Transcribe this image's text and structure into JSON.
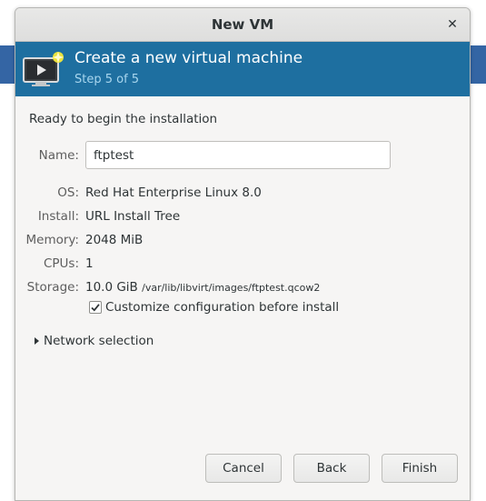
{
  "window": {
    "title": "New VM"
  },
  "banner": {
    "heading": "Create a new virtual machine",
    "step": "Step 5 of 5"
  },
  "summary": {
    "intro": "Ready to begin the installation",
    "name_label": "Name:",
    "name_value": "ftptest",
    "os_label": "OS:",
    "os_value": "Red Hat Enterprise Linux 8.0",
    "install_label": "Install:",
    "install_value": "URL Install Tree",
    "memory_label": "Memory:",
    "memory_value": "2048 MiB",
    "cpus_label": "CPUs:",
    "cpus_value": "1",
    "storage_label": "Storage:",
    "storage_size": "10.0 GiB",
    "storage_path": "/var/lib/libvirt/images/ftptest.qcow2"
  },
  "options": {
    "customize_label": "Customize configuration before install",
    "customize_checked": true,
    "network_label": "Network selection"
  },
  "buttons": {
    "cancel": "Cancel",
    "back": "Back",
    "finish": "Finish"
  },
  "icons": {
    "close": "close-icon",
    "banner": "vm-monitor-icon",
    "expander": "triangle-right-icon",
    "check": "check-icon"
  },
  "colors": {
    "banner_bg": "#1e6fa0",
    "banner_subtext": "#a8d6ee"
  }
}
